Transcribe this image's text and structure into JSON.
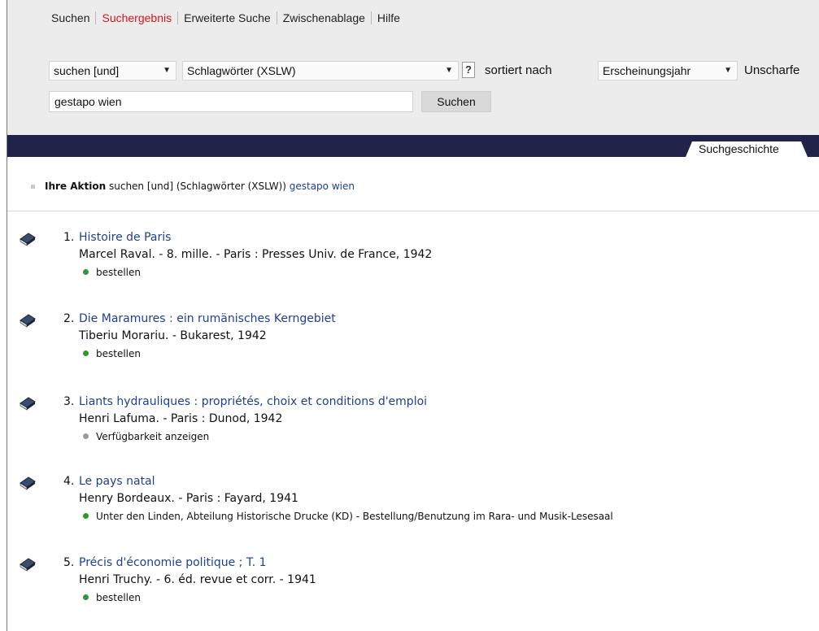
{
  "tabs": [
    "Suchen",
    "Suchergebnis",
    "Erweiterte Suche",
    "Zwischenablage",
    "Hilfe"
  ],
  "active_tab": "Suchergebnis",
  "search": {
    "operator": "suchen [und]",
    "field": "Schlagwörter (XSLW)",
    "help": "?",
    "sort_label": "sortiert nach",
    "sort_value": "Erscheinungsjahr",
    "fuzzy_label": "Unscharfe",
    "query": "gestapo wien",
    "button": "Suchen"
  },
  "history_tab": "Suchgeschichte",
  "action": {
    "label": "Ihre Aktion",
    "text": "suchen [und] (Schlagwörter (XSLW))",
    "query": "gestapo wien"
  },
  "results": [
    {
      "num": "1.",
      "title": "Histoire de Paris",
      "meta": "Marcel Raval. - 8. mille. - Paris : Presses Univ. de France, 1942",
      "status": "bestellen",
      "status_color": "#2e9a2e"
    },
    {
      "num": "2.",
      "title": "Die Maramures : ein rumänisches Kerngebiet",
      "meta": "Tiberiu Morariu. - Bukarest, 1942",
      "status": "bestellen",
      "status_color": "#2e9a2e"
    },
    {
      "num": "3.",
      "title": "Liants hydrauliques : propriétés, choix et conditions d'emploi",
      "meta": "Henri Lafuma. - Paris : Dunod, 1942",
      "status": "Verfügbarkeit anzeigen",
      "status_color": "#9a9a9a"
    },
    {
      "num": "4.",
      "title": "Le pays natal",
      "meta": "Henry Bordeaux. - Paris : Fayard, 1941",
      "status": "Unter den Linden, Abteilung Historische Drucke (KD) - Bestellung/Benutzung im Rara- und Musik-Lesesaal",
      "status_color": "#2e9a2e"
    },
    {
      "num": "5.",
      "title": "Précis d'économie politique ; T. 1",
      "meta": "Henri Truchy. - 6. éd. revue et corr. - 1941",
      "status": "bestellen",
      "status_color": "#2e9a2e"
    }
  ],
  "colors": {
    "accent_red": "#d8141b",
    "link_blue": "#1f3f95",
    "bar_navy": "#22234a"
  }
}
